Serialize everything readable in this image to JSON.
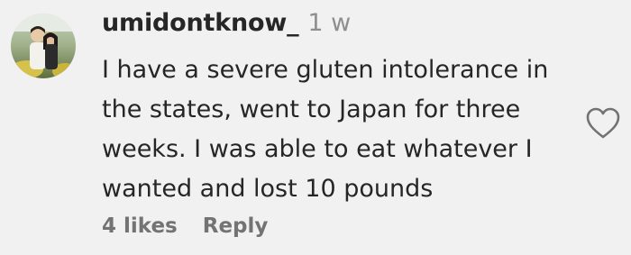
{
  "comment": {
    "username": "umidontknow_",
    "timestamp": "1 w",
    "text_lines": [
      "I have a severe gluten intolerance in",
      "the states, went to Japan for three",
      "weeks. I was able to eat whatever I",
      "wanted and lost 10 pounds"
    ],
    "likes": "4 likes",
    "reply": "Reply",
    "icons": {
      "like": "heart-outline-icon",
      "avatar": "profile-photo"
    }
  },
  "colors": {
    "background": "#f1f1f1",
    "text": "#262626",
    "muted": "#8e8e8e",
    "footer": "#737373"
  }
}
